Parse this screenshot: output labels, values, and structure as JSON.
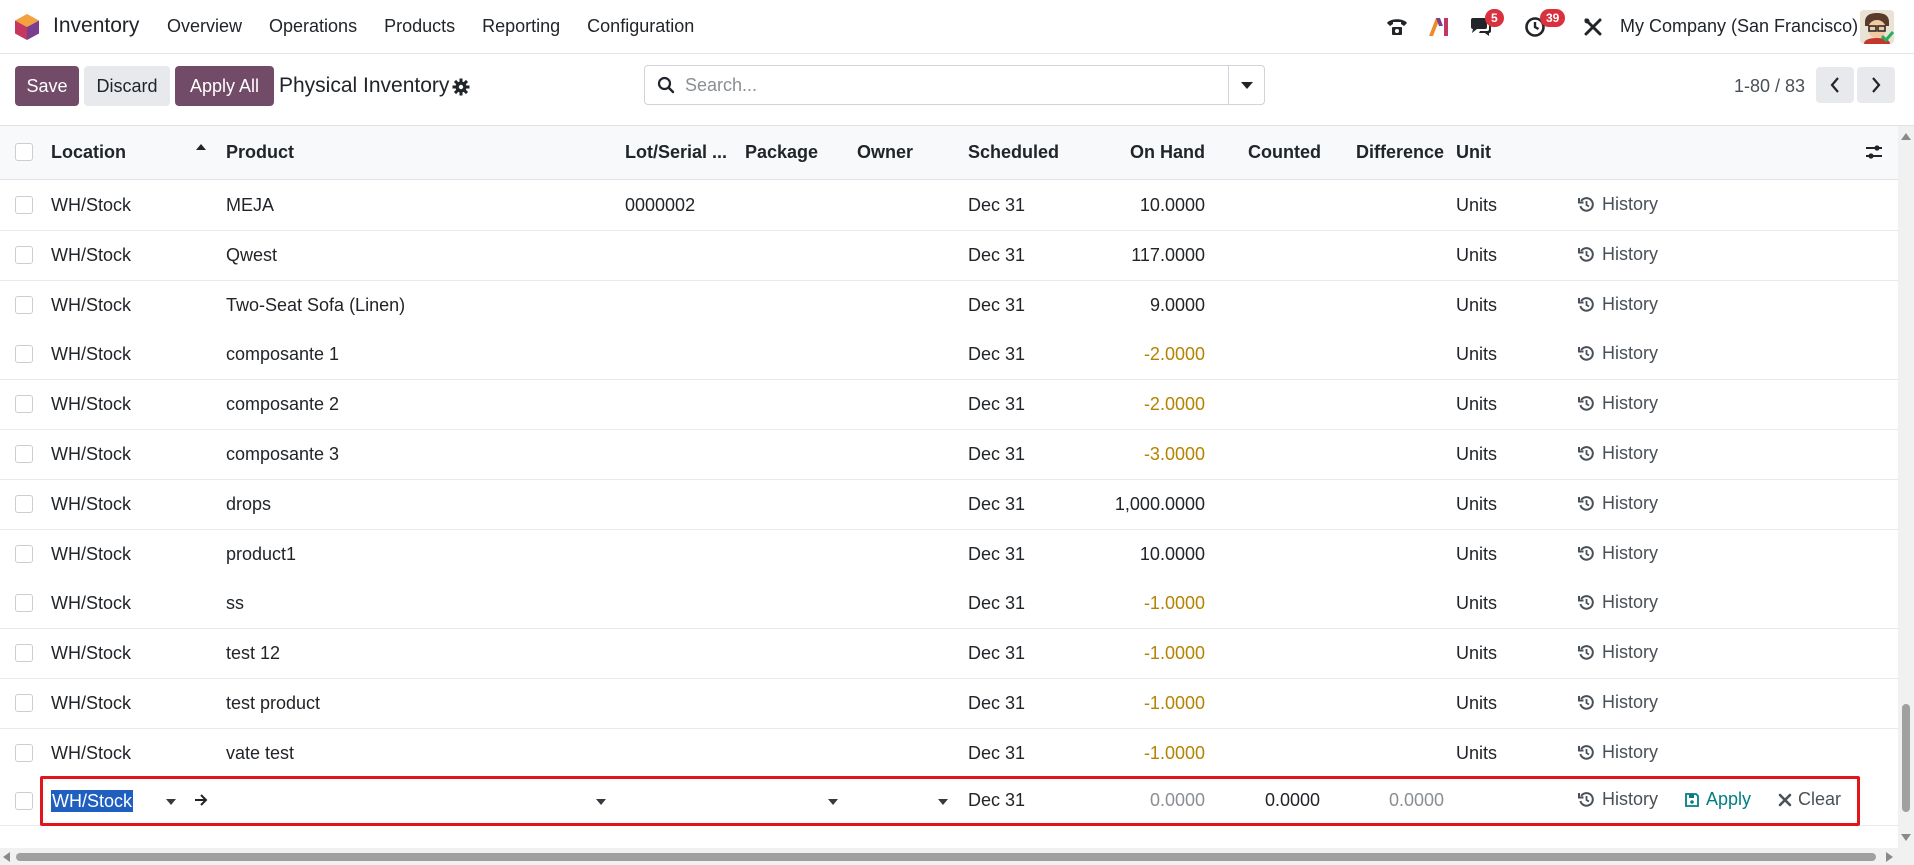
{
  "navbar": {
    "app_name": "Inventory",
    "menu": [
      "Overview",
      "Operations",
      "Products",
      "Reporting",
      "Configuration"
    ],
    "messages_badge": "5",
    "activities_badge": "39",
    "company": "My Company (San Francisco)",
    "accent_color": "#714b67"
  },
  "control_panel": {
    "save_label": "Save",
    "discard_label": "Discard",
    "apply_all_label": "Apply All",
    "title": "Physical Inventory",
    "search_placeholder": "Search...",
    "pager": "1-80 / 83"
  },
  "table": {
    "columns": {
      "location": "Location",
      "product": "Product",
      "lot": "Lot/Serial ...",
      "package": "Package",
      "owner": "Owner",
      "scheduled": "Scheduled",
      "on_hand": "On Hand",
      "counted": "Counted",
      "difference": "Difference",
      "unit": "Unit"
    },
    "history_label": "History",
    "rows": [
      {
        "location": "WH/Stock",
        "product": "MEJA",
        "lot": "0000002",
        "scheduled": "Dec 31",
        "on_hand": "10.0000",
        "negative": false,
        "unit": "Units"
      },
      {
        "location": "WH/Stock",
        "product": "Qwest",
        "lot": "",
        "scheduled": "Dec 31",
        "on_hand": "117.0000",
        "negative": false,
        "unit": "Units"
      },
      {
        "location": "WH/Stock",
        "product": "Two-Seat Sofa (Linen)",
        "lot": "",
        "scheduled": "Dec 31",
        "on_hand": "9.0000",
        "negative": false,
        "unit": "Units"
      },
      {
        "location": "WH/Stock",
        "product": "composante 1",
        "lot": "",
        "scheduled": "Dec 31",
        "on_hand": "-2.0000",
        "negative": true,
        "unit": "Units"
      },
      {
        "location": "WH/Stock",
        "product": "composante 2",
        "lot": "",
        "scheduled": "Dec 31",
        "on_hand": "-2.0000",
        "negative": true,
        "unit": "Units"
      },
      {
        "location": "WH/Stock",
        "product": "composante 3",
        "lot": "",
        "scheduled": "Dec 31",
        "on_hand": "-3.0000",
        "negative": true,
        "unit": "Units"
      },
      {
        "location": "WH/Stock",
        "product": "drops",
        "lot": "",
        "scheduled": "Dec 31",
        "on_hand": "1,000.0000",
        "negative": false,
        "unit": "Units"
      },
      {
        "location": "WH/Stock",
        "product": "product1",
        "lot": "",
        "scheduled": "Dec 31",
        "on_hand": "10.0000",
        "negative": false,
        "unit": "Units"
      },
      {
        "location": "WH/Stock",
        "product": "ss",
        "lot": "",
        "scheduled": "Dec 31",
        "on_hand": "-1.0000",
        "negative": true,
        "unit": "Units"
      },
      {
        "location": "WH/Stock",
        "product": "test 12",
        "lot": "",
        "scheduled": "Dec 31",
        "on_hand": "-1.0000",
        "negative": true,
        "unit": "Units"
      },
      {
        "location": "WH/Stock",
        "product": "test product",
        "lot": "",
        "scheduled": "Dec 31",
        "on_hand": "-1.0000",
        "negative": true,
        "unit": "Units"
      },
      {
        "location": "WH/Stock",
        "product": "vate test",
        "lot": "",
        "scheduled": "Dec 31",
        "on_hand": "-1.0000",
        "negative": true,
        "unit": "Units"
      }
    ],
    "edit_row": {
      "location": "WH/Stock",
      "scheduled": "Dec 31",
      "on_hand": "0.0000",
      "counted": "0.0000",
      "difference": "0.0000",
      "history_label": "History",
      "apply_label": "Apply",
      "clear_label": "Clear"
    },
    "negative_color": "#b58300",
    "highlight_color": "#e0161b"
  }
}
